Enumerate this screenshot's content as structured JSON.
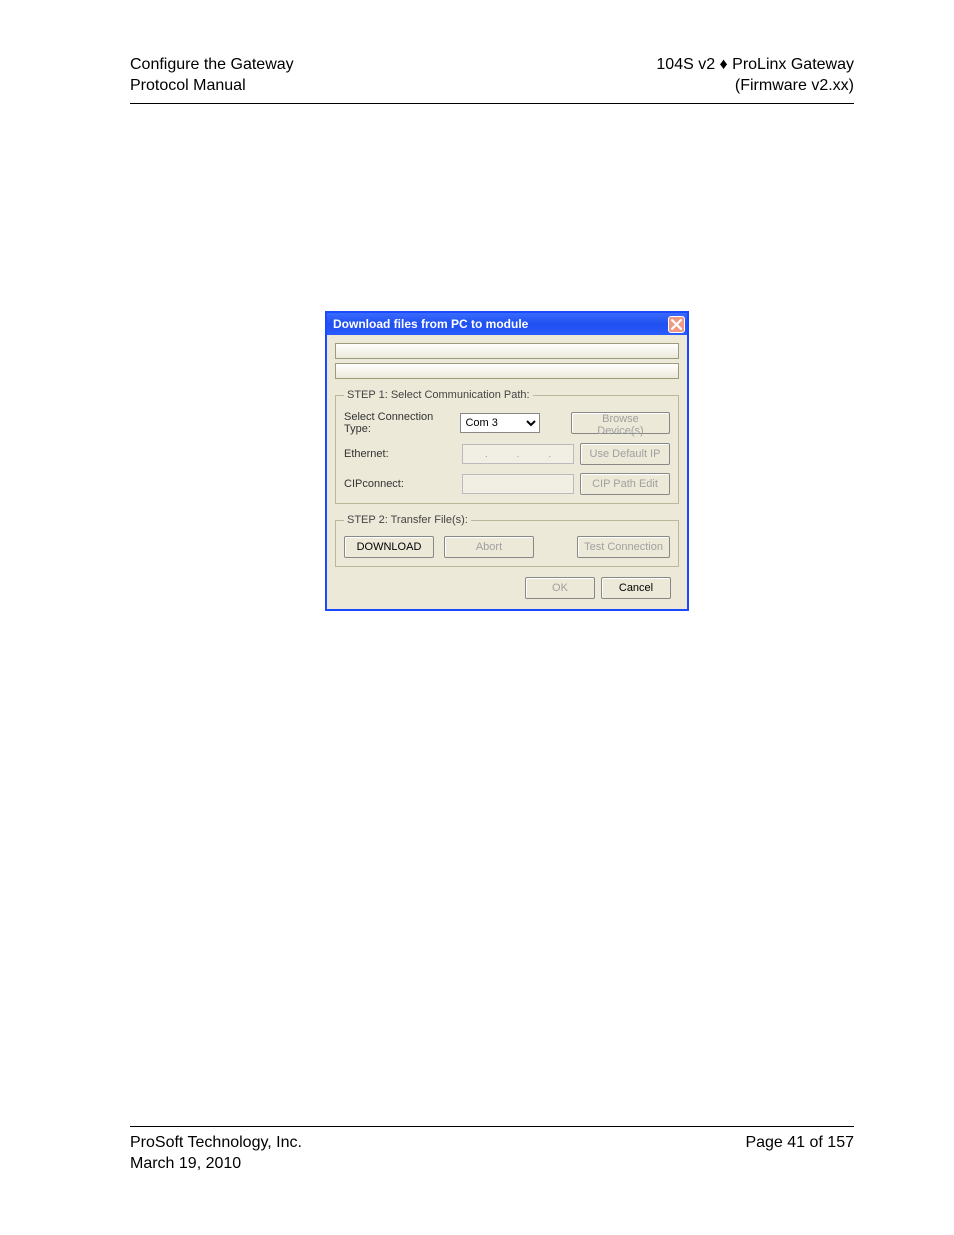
{
  "header": {
    "left1": "Configure the Gateway",
    "left2": "Protocol Manual",
    "right1": "104S v2 ♦ ProLinx Gateway",
    "right2": "(Firmware v2.xx)"
  },
  "footer": {
    "left1": "ProSoft Technology, Inc.",
    "left2": "March 19, 2010",
    "right1": "Page 41 of 157"
  },
  "dialog": {
    "title": "Download files from PC to module",
    "step1": {
      "legend": "STEP 1: Select Communication Path:",
      "row1": {
        "label": "Select Connection Type:",
        "value": "Com 3",
        "button": "Browse Device(s)"
      },
      "row2": {
        "label": "Ethernet:",
        "button": "Use Default IP"
      },
      "row3": {
        "label": "CIPconnect:",
        "button": "CIP Path Edit"
      }
    },
    "step2": {
      "legend": "STEP 2: Transfer File(s):",
      "download": "DOWNLOAD",
      "abort": "Abort",
      "test": "Test Connection"
    },
    "ok": "OK",
    "cancel": "Cancel"
  }
}
